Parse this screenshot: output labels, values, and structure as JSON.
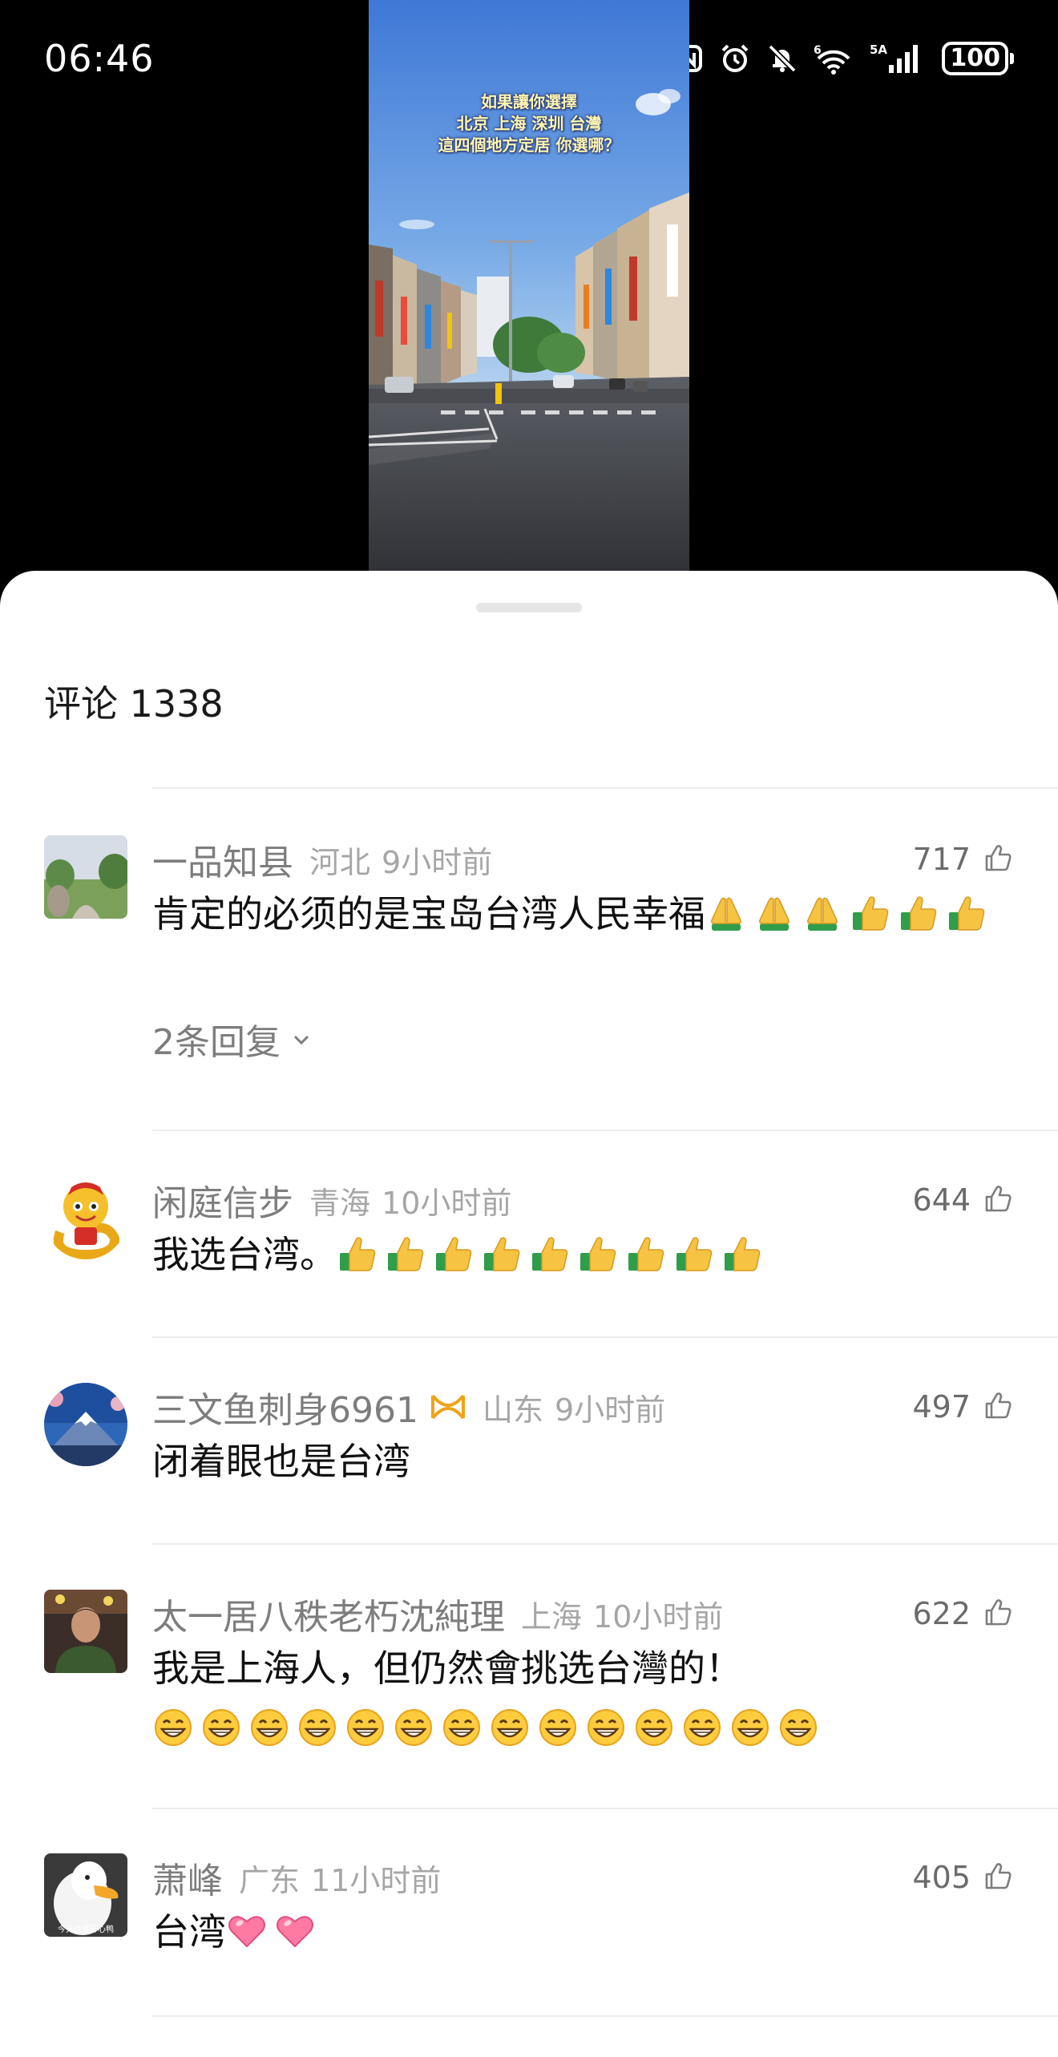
{
  "status_bar": {
    "time": "06:46",
    "icons": [
      "nfc-icon",
      "alarm-icon",
      "mute-bell-icon",
      "wifi-6-icon",
      "cellular-5a-icon",
      "battery-icon"
    ],
    "network_label": "6",
    "cellular_label": "5A",
    "battery": "100"
  },
  "video": {
    "caption_lines": [
      "如果讓你選擇",
      "北京 上海 深圳 台灣",
      "這四個地方定居 你選哪？"
    ]
  },
  "comments": {
    "title": "评论 1338",
    "items": [
      {
        "username": "一品知县",
        "location": "河北",
        "time": "9小时前",
        "likes": "717",
        "text": "肯定的必须的是宝岛台湾人民幸福",
        "emojis": [
          "pray",
          "pray",
          "pray",
          "thumbs-up",
          "thumbs-up",
          "thumbs-up"
        ],
        "replies": "2条回复"
      },
      {
        "username": "闲庭信步",
        "location": "青海",
        "time": "10小时前",
        "likes": "644",
        "text": "我选台湾。",
        "emojis": [
          "thumbs-up",
          "thumbs-up",
          "thumbs-up",
          "thumbs-up",
          "thumbs-up",
          "thumbs-up",
          "thumbs-up",
          "thumbs-up",
          "thumbs-up"
        ]
      },
      {
        "username": "三文鱼刺身6961",
        "badge": "member-badge-icon",
        "location": "山东",
        "time": "9小时前",
        "likes": "497",
        "text": "闭着眼也是台湾"
      },
      {
        "username": "太一居八秩老朽沈純理",
        "location": "上海",
        "time": "10小时前",
        "likes": "622",
        "text": "我是上海人，但仍然會挑选台灣的！",
        "emojis": [
          "grin",
          "grin",
          "grin",
          "grin",
          "grin",
          "grin",
          "grin",
          "grin",
          "grin",
          "grin",
          "grin",
          "grin",
          "grin",
          "grin"
        ]
      },
      {
        "username": "萧峰",
        "location": "广东",
        "time": "11小时前",
        "likes": "405",
        "text": "台湾",
        "emojis": [
          "heart",
          "heart"
        ],
        "avatar_text": "今天也要开心鸭"
      }
    ]
  },
  "colors": {
    "background": "#000000",
    "sheet": "#ffffff",
    "username": "#7d7d7d",
    "meta": "#a6a6a6",
    "text": "#111111",
    "divider": "#ececec"
  }
}
